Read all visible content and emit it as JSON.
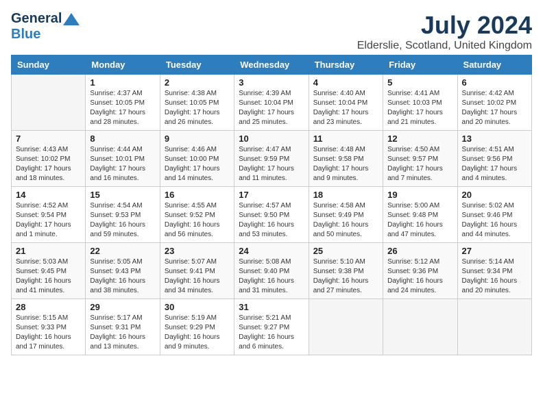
{
  "header": {
    "logo_line1": "General",
    "logo_line2": "Blue",
    "month_year": "July 2024",
    "location": "Elderslie, Scotland, United Kingdom"
  },
  "weekdays": [
    "Sunday",
    "Monday",
    "Tuesday",
    "Wednesday",
    "Thursday",
    "Friday",
    "Saturday"
  ],
  "weeks": [
    [
      {
        "day": "",
        "sunrise": "",
        "sunset": "",
        "daylight": ""
      },
      {
        "day": "1",
        "sunrise": "4:37 AM",
        "sunset": "10:05 PM",
        "daylight": "17 hours and 28 minutes."
      },
      {
        "day": "2",
        "sunrise": "4:38 AM",
        "sunset": "10:05 PM",
        "daylight": "17 hours and 26 minutes."
      },
      {
        "day": "3",
        "sunrise": "4:39 AM",
        "sunset": "10:04 PM",
        "daylight": "17 hours and 25 minutes."
      },
      {
        "day": "4",
        "sunrise": "4:40 AM",
        "sunset": "10:04 PM",
        "daylight": "17 hours and 23 minutes."
      },
      {
        "day": "5",
        "sunrise": "4:41 AM",
        "sunset": "10:03 PM",
        "daylight": "17 hours and 21 minutes."
      },
      {
        "day": "6",
        "sunrise": "4:42 AM",
        "sunset": "10:02 PM",
        "daylight": "17 hours and 20 minutes."
      }
    ],
    [
      {
        "day": "7",
        "sunrise": "4:43 AM",
        "sunset": "10:02 PM",
        "daylight": "17 hours and 18 minutes."
      },
      {
        "day": "8",
        "sunrise": "4:44 AM",
        "sunset": "10:01 PM",
        "daylight": "17 hours and 16 minutes."
      },
      {
        "day": "9",
        "sunrise": "4:46 AM",
        "sunset": "10:00 PM",
        "daylight": "17 hours and 14 minutes."
      },
      {
        "day": "10",
        "sunrise": "4:47 AM",
        "sunset": "9:59 PM",
        "daylight": "17 hours and 11 minutes."
      },
      {
        "day": "11",
        "sunrise": "4:48 AM",
        "sunset": "9:58 PM",
        "daylight": "17 hours and 9 minutes."
      },
      {
        "day": "12",
        "sunrise": "4:50 AM",
        "sunset": "9:57 PM",
        "daylight": "17 hours and 7 minutes."
      },
      {
        "day": "13",
        "sunrise": "4:51 AM",
        "sunset": "9:56 PM",
        "daylight": "17 hours and 4 minutes."
      }
    ],
    [
      {
        "day": "14",
        "sunrise": "4:52 AM",
        "sunset": "9:54 PM",
        "daylight": "17 hours and 1 minute."
      },
      {
        "day": "15",
        "sunrise": "4:54 AM",
        "sunset": "9:53 PM",
        "daylight": "16 hours and 59 minutes."
      },
      {
        "day": "16",
        "sunrise": "4:55 AM",
        "sunset": "9:52 PM",
        "daylight": "16 hours and 56 minutes."
      },
      {
        "day": "17",
        "sunrise": "4:57 AM",
        "sunset": "9:50 PM",
        "daylight": "16 hours and 53 minutes."
      },
      {
        "day": "18",
        "sunrise": "4:58 AM",
        "sunset": "9:49 PM",
        "daylight": "16 hours and 50 minutes."
      },
      {
        "day": "19",
        "sunrise": "5:00 AM",
        "sunset": "9:48 PM",
        "daylight": "16 hours and 47 minutes."
      },
      {
        "day": "20",
        "sunrise": "5:02 AM",
        "sunset": "9:46 PM",
        "daylight": "16 hours and 44 minutes."
      }
    ],
    [
      {
        "day": "21",
        "sunrise": "5:03 AM",
        "sunset": "9:45 PM",
        "daylight": "16 hours and 41 minutes."
      },
      {
        "day": "22",
        "sunrise": "5:05 AM",
        "sunset": "9:43 PM",
        "daylight": "16 hours and 38 minutes."
      },
      {
        "day": "23",
        "sunrise": "5:07 AM",
        "sunset": "9:41 PM",
        "daylight": "16 hours and 34 minutes."
      },
      {
        "day": "24",
        "sunrise": "5:08 AM",
        "sunset": "9:40 PM",
        "daylight": "16 hours and 31 minutes."
      },
      {
        "day": "25",
        "sunrise": "5:10 AM",
        "sunset": "9:38 PM",
        "daylight": "16 hours and 27 minutes."
      },
      {
        "day": "26",
        "sunrise": "5:12 AM",
        "sunset": "9:36 PM",
        "daylight": "16 hours and 24 minutes."
      },
      {
        "day": "27",
        "sunrise": "5:14 AM",
        "sunset": "9:34 PM",
        "daylight": "16 hours and 20 minutes."
      }
    ],
    [
      {
        "day": "28",
        "sunrise": "5:15 AM",
        "sunset": "9:33 PM",
        "daylight": "16 hours and 17 minutes."
      },
      {
        "day": "29",
        "sunrise": "5:17 AM",
        "sunset": "9:31 PM",
        "daylight": "16 hours and 13 minutes."
      },
      {
        "day": "30",
        "sunrise": "5:19 AM",
        "sunset": "9:29 PM",
        "daylight": "16 hours and 9 minutes."
      },
      {
        "day": "31",
        "sunrise": "5:21 AM",
        "sunset": "9:27 PM",
        "daylight": "16 hours and 6 minutes."
      },
      {
        "day": "",
        "sunrise": "",
        "sunset": "",
        "daylight": ""
      },
      {
        "day": "",
        "sunrise": "",
        "sunset": "",
        "daylight": ""
      },
      {
        "day": "",
        "sunrise": "",
        "sunset": "",
        "daylight": ""
      }
    ]
  ]
}
